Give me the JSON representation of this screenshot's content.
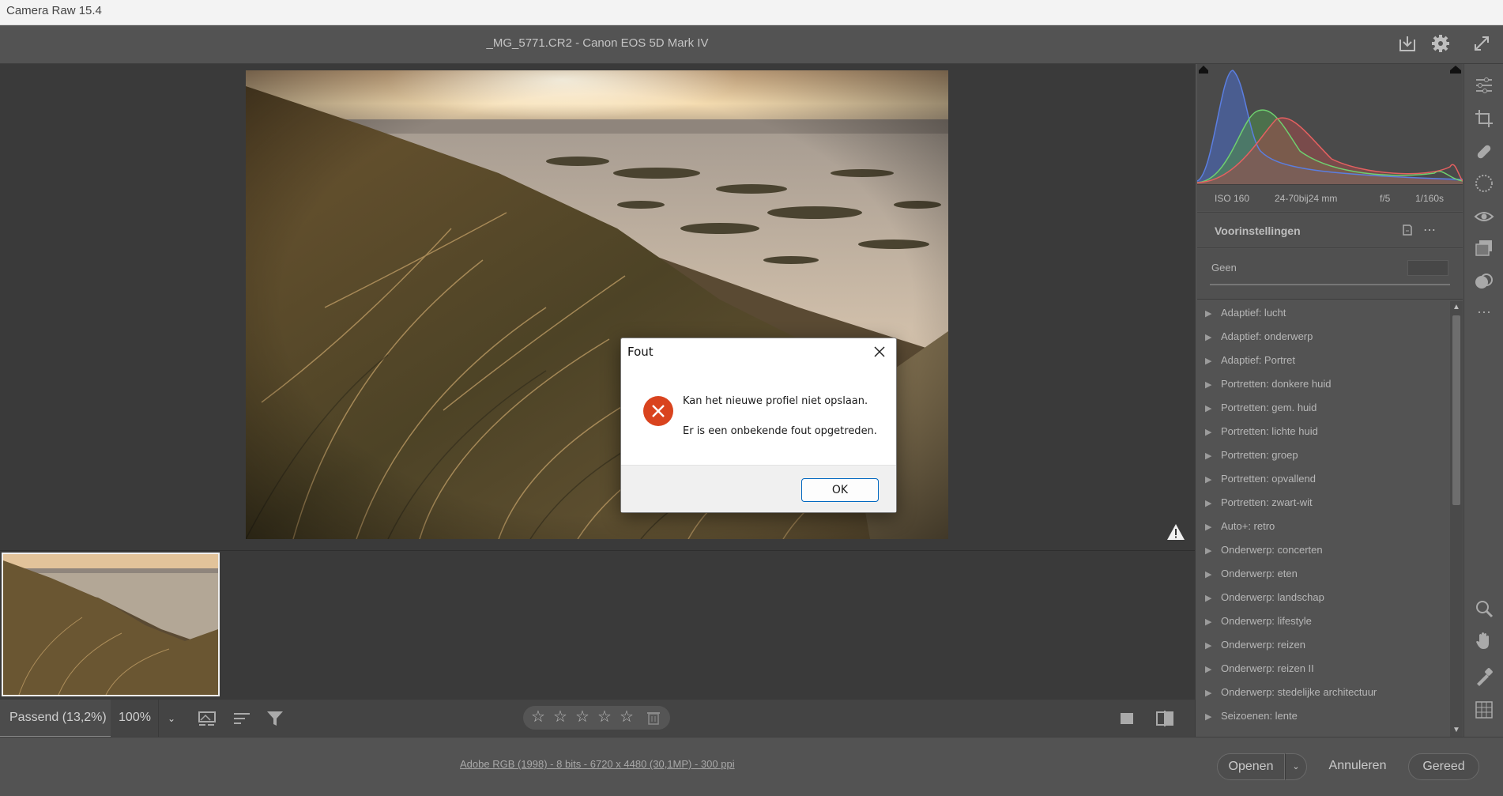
{
  "window": {
    "title": "Camera Raw 15.4"
  },
  "header": {
    "file_title": "_MG_5771.CR2  -  Canon EOS 5D Mark IV"
  },
  "exif": {
    "iso": "ISO 160",
    "lens": "24-70bij24 mm",
    "aperture": "f/5",
    "shutter": "1/160s"
  },
  "presets": {
    "title": "Voorinstellingen",
    "none_label": "Geen",
    "items": [
      "Adaptief: lucht",
      "Adaptief: onderwerp",
      "Adaptief: Portret",
      "Portretten: donkere huid",
      "Portretten: gem. huid",
      "Portretten: lichte huid",
      "Portretten: groep",
      "Portretten: opvallend",
      "Portretten: zwart-wit",
      "Auto+: retro",
      "Onderwerp: concerten",
      "Onderwerp: eten",
      "Onderwerp: landschap",
      "Onderwerp: lifestyle",
      "Onderwerp: reizen",
      "Onderwerp: reizen II",
      "Onderwerp: stedelijke architectuur",
      "Seizoenen: lente"
    ]
  },
  "toolbar": {
    "zoom_fit": "Passend (13,2%)",
    "zoom_100": "100%",
    "rating_stars": 0
  },
  "footer": {
    "workflow": "Adobe RGB (1998) - 8 bits - 6720 x 4480 (30,1MP) - 300 ppi",
    "open": "Openen",
    "cancel": "Annuleren",
    "done": "Gereed"
  },
  "dialog": {
    "title": "Fout",
    "message": "Kan het nieuwe profiel niet opslaan.",
    "detail": "Er is een onbekende fout opgetreden.",
    "ok": "OK"
  },
  "colors": {
    "accent": "#0067c0",
    "error": "#d9431e",
    "panel": "#535353",
    "canvas": "#3a3a3a"
  }
}
